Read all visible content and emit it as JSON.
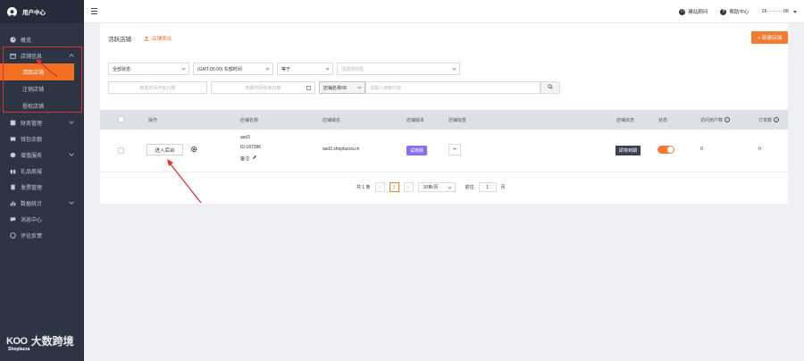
{
  "sidebar": {
    "title": "用户中心",
    "items": [
      {
        "label": "概览",
        "icon": "dashboard-icon"
      },
      {
        "label": "店铺信息",
        "icon": "store-icon",
        "expanded": true,
        "children": [
          {
            "label": "活跃店铺",
            "active": true
          },
          {
            "label": "注销店铺"
          },
          {
            "label": "授权店铺"
          }
        ]
      },
      {
        "label": "财务管理",
        "icon": "finance-icon"
      },
      {
        "label": "钱包余额",
        "icon": "wallet-icon"
      },
      {
        "label": "增值服务",
        "icon": "service-icon"
      },
      {
        "label": "礼品商城",
        "icon": "gift-icon"
      },
      {
        "label": "发票管理",
        "icon": "invoice-icon"
      },
      {
        "label": "数据统计",
        "icon": "chart-icon"
      },
      {
        "label": "消息中心",
        "icon": "message-icon"
      },
      {
        "label": "评论反馈",
        "icon": "feedback-icon"
      }
    ]
  },
  "watermark": {
    "logo": "KOO",
    "text": "大数跨境",
    "sub": "Shoplazza"
  },
  "topbar": {
    "links": [
      "建站顾问",
      "帮助中心"
    ],
    "account": "16··········06"
  },
  "page": {
    "title": "活跃店铺",
    "export_label": "店铺导出",
    "new_button": "+ 新建店铺"
  },
  "filters": {
    "status": "全部状态",
    "timezone": "(GMT-05:00) 东部时间",
    "compare": "等于",
    "label_placeholder": "请选择标签",
    "start_date_placeholder": "到期时间开始日期",
    "end_date_placeholder": "到期时间结束日期",
    "search_type": "店铺名称/ID",
    "search_placeholder": "请输入搜索内容"
  },
  "table": {
    "columns": [
      "操作",
      "店铺名称",
      "店铺域名",
      "店铺版本",
      "店铺标签",
      "店铺状态",
      "状态",
      "访问用户数",
      "订单数"
    ],
    "rows": [
      {
        "action": "进入后台",
        "name": "asd3",
        "id": "ID:187396",
        "note": "备注:",
        "domain": "asd3.shoplazza.cn",
        "version": "试用版",
        "status_tag": "即将到期",
        "visitors": "0",
        "orders": "0",
        "enabled": true
      }
    ]
  },
  "pagination": {
    "total": "共 1 条",
    "current": "1",
    "per_page": "10条/页",
    "goto_label": "前往",
    "goto_value": "1",
    "page_unit": "页"
  },
  "colors": {
    "accent": "#f37a2f",
    "sidebar": "#2d3544",
    "annotation": "#e0302d"
  }
}
